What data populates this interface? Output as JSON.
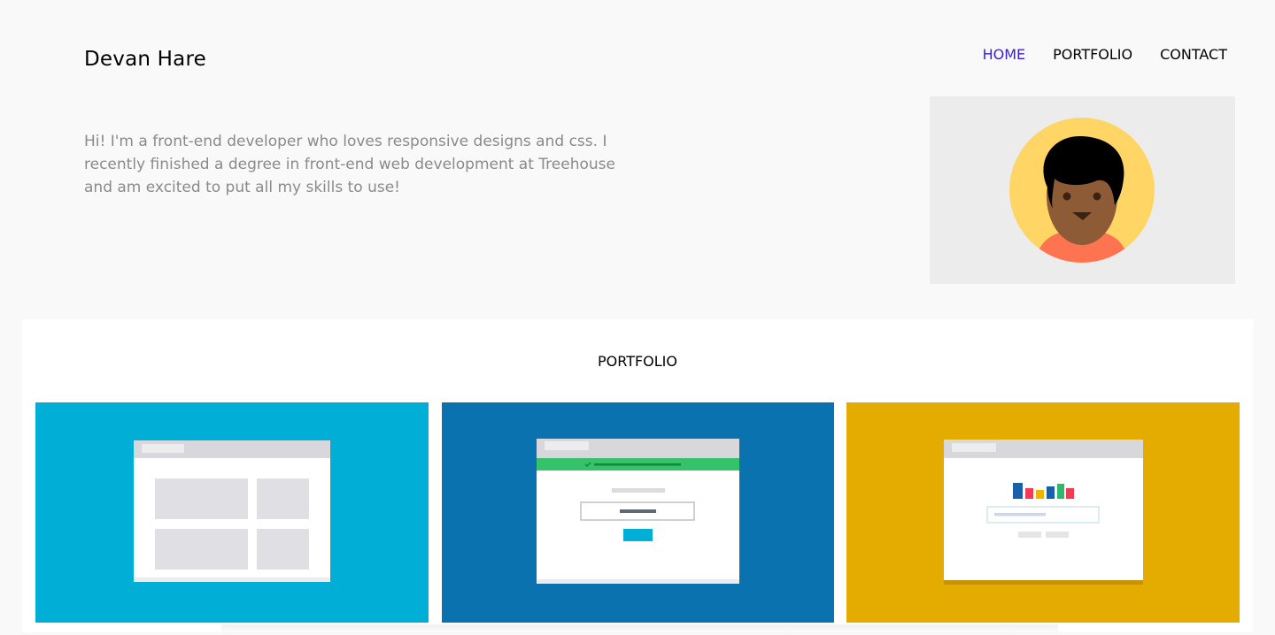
{
  "header": {
    "brand": "Devan Hare",
    "nav": [
      {
        "label": "HOME",
        "active": true
      },
      {
        "label": "PORTFOLIO",
        "active": false
      },
      {
        "label": "CONTACT",
        "active": false
      }
    ]
  },
  "intro": {
    "text": "Hi! I'm a front-end developer who loves responsive designs and css. I recently finished a degree in front-end web development at Treehouse and am excited to put all my skills to use!"
  },
  "avatar": {
    "icon": "avatar-illustration"
  },
  "portfolio": {
    "title": "PORTFOLIO",
    "cards": [
      {
        "icon": "layout-grid-mockup",
        "color": "#01aed5"
      },
      {
        "icon": "signup-form-mockup",
        "color": "#0a72ae"
      },
      {
        "icon": "analytics-dashboard-mockup",
        "color": "#e4ab00"
      }
    ]
  },
  "colors": {
    "background": "#f9f9f9",
    "nav_active": "#3a1fd1",
    "intro_text": "#8a8a8a",
    "avatar_bg": "#ececec"
  }
}
